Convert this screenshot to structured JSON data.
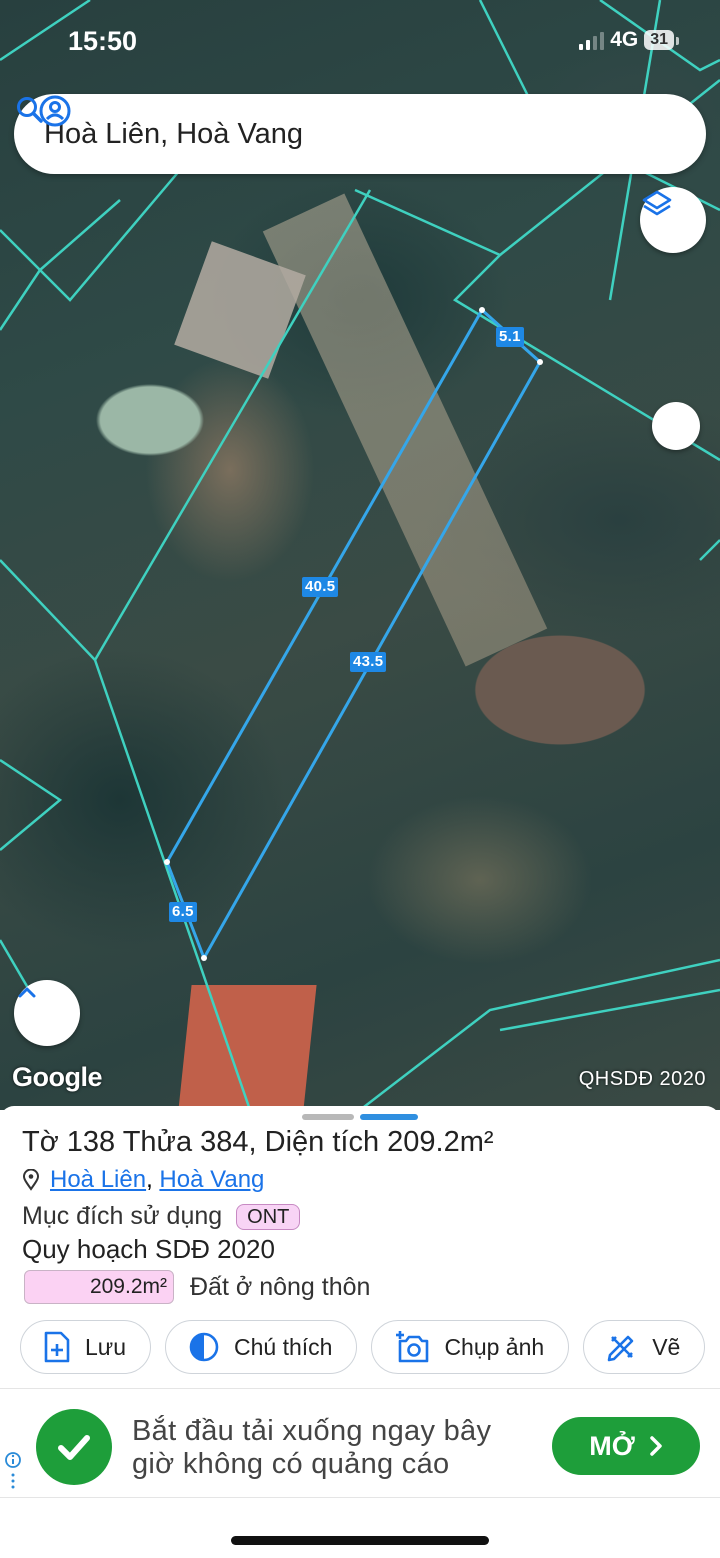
{
  "status_bar": {
    "time": "15:50",
    "network": "4G",
    "battery": "31"
  },
  "search": {
    "query": "Hoà Liên, Hoà Vang"
  },
  "map": {
    "dimensions": {
      "top": "5.1",
      "left": "40.5",
      "right": "43.5",
      "bottom": "6.5"
    },
    "attribution": "Google",
    "layer_name": "QHSDĐ 2020"
  },
  "parcel": {
    "title": "Tờ 138 Thửa 384, Diện tích 209.2m²",
    "commune": "Hoà Liên",
    "separator": ",",
    "district": "Hoà Vang",
    "purpose_label": "Mục đích sử dụng",
    "purpose_code": "ONT",
    "plan_label": "Quy hoạch SDĐ 2020",
    "area_value": "209.2m²",
    "area_type": "Đất ở nông thôn"
  },
  "actions": [
    {
      "label": "Lưu",
      "icon": "file-plus-icon"
    },
    {
      "label": "Chú thích",
      "icon": "half-circle-icon"
    },
    {
      "label": "Chụp ảnh",
      "icon": "camera-plus-icon"
    },
    {
      "label": "Vẽ",
      "icon": "pencil-ruler-icon"
    }
  ],
  "ad": {
    "text": "Bắt đầu tải xuống ngay bây giờ không có quảng cáo",
    "button": "MỞ"
  },
  "colors": {
    "boundary": "#3fd1c0",
    "parcel_line": "#35a6ea",
    "label_bg": "#1e88e5",
    "ad_green": "#1e9e3a",
    "badge_pink": "#f8d4f5"
  }
}
